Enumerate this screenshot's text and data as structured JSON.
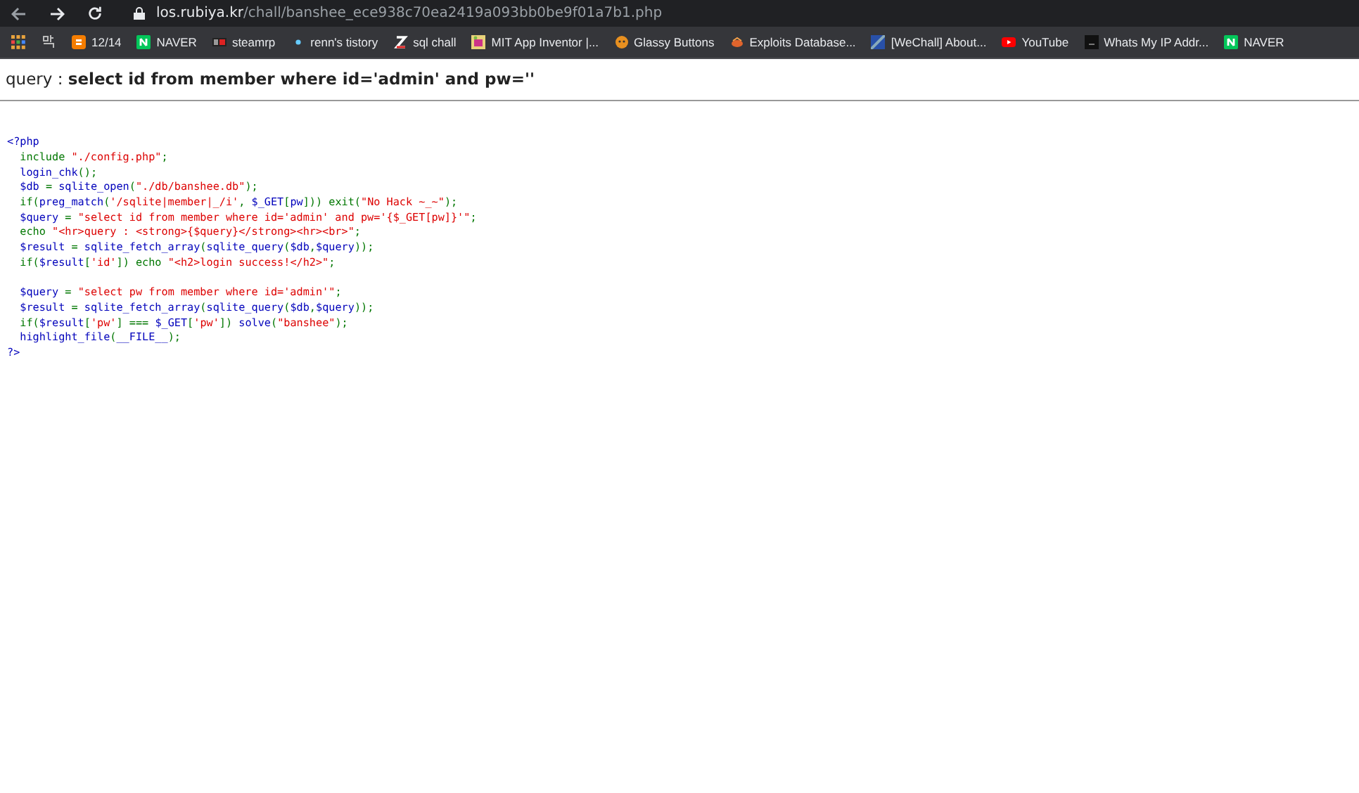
{
  "browser": {
    "url_host": "los.rubiya.kr",
    "url_path": "/chall/banshee_ece938c70ea2419a093bb0be9f01a7b1.php"
  },
  "bookmarks": [
    {
      "label": "12/14",
      "kind": "blogger"
    },
    {
      "label": "NAVER",
      "kind": "naver"
    },
    {
      "label": "steamrp",
      "kind": "steam"
    },
    {
      "label": "renn's tistory",
      "kind": "dot"
    },
    {
      "label": "sql chall",
      "kind": "z"
    },
    {
      "label": "MIT App Inventor |...",
      "kind": "mit"
    },
    {
      "label": "Glassy Buttons",
      "kind": "glassy"
    },
    {
      "label": "Exploits Database...",
      "kind": "exploit"
    },
    {
      "label": "[WeChall] About...",
      "kind": "wechall"
    },
    {
      "label": "YouTube",
      "kind": "youtube"
    },
    {
      "label": "Whats My IP Addr...",
      "kind": "dark"
    },
    {
      "label": "NAVER",
      "kind": "naver"
    }
  ],
  "query_line": "query : **select id from member where id='admin' and pw=''**",
  "code_groups": [
    [
      [
        {
          "text": "<?php",
          "kind": "default"
        }
      ],
      [
        {
          "text": "  include ",
          "kind": "keyword"
        },
        {
          "text": "\"./config.php\"",
          "kind": "string"
        },
        {
          "text": ";",
          "kind": "keyword"
        }
      ],
      [
        {
          "text": "  login_chk",
          "kind": "default"
        },
        {
          "text": "();",
          "kind": "keyword"
        }
      ],
      [
        {
          "text": "  $db ",
          "kind": "default"
        },
        {
          "text": "= ",
          "kind": "keyword"
        },
        {
          "text": "sqlite_open",
          "kind": "default"
        },
        {
          "text": "(",
          "kind": "keyword"
        },
        {
          "text": "\"./db/banshee.db\"",
          "kind": "string"
        },
        {
          "text": ");",
          "kind": "keyword"
        }
      ],
      [
        {
          "text": "  if(",
          "kind": "keyword"
        },
        {
          "text": "preg_match",
          "kind": "default"
        },
        {
          "text": "(",
          "kind": "keyword"
        },
        {
          "text": "'/sqlite|member|_/i'",
          "kind": "string"
        },
        {
          "text": ", ",
          "kind": "keyword"
        },
        {
          "text": "$_GET",
          "kind": "default"
        },
        {
          "text": "[",
          "kind": "keyword"
        },
        {
          "text": "pw",
          "kind": "default"
        },
        {
          "text": "])) exit(",
          "kind": "keyword"
        },
        {
          "text": "\"No Hack ~_~\"",
          "kind": "string"
        },
        {
          "text": ");",
          "kind": "keyword"
        }
      ],
      [
        {
          "text": "  $query ",
          "kind": "default"
        },
        {
          "text": "= ",
          "kind": "keyword"
        },
        {
          "text": "\"select id from member where id='admin' and pw='{$_GET[pw]}'\"",
          "kind": "string"
        },
        {
          "text": ";",
          "kind": "keyword"
        }
      ],
      [
        {
          "text": "  echo ",
          "kind": "keyword"
        },
        {
          "text": "\"<hr>query : <strong>{$query}</strong><hr><br>\"",
          "kind": "string"
        },
        {
          "text": ";",
          "kind": "keyword"
        }
      ],
      [
        {
          "text": "  $result ",
          "kind": "default"
        },
        {
          "text": "= ",
          "kind": "keyword"
        },
        {
          "text": "sqlite_fetch_array",
          "kind": "default"
        },
        {
          "text": "(",
          "kind": "keyword"
        },
        {
          "text": "sqlite_query",
          "kind": "default"
        },
        {
          "text": "(",
          "kind": "keyword"
        },
        {
          "text": "$db",
          "kind": "default"
        },
        {
          "text": ",",
          "kind": "keyword"
        },
        {
          "text": "$query",
          "kind": "default"
        },
        {
          "text": "));",
          "kind": "keyword"
        }
      ],
      [
        {
          "text": "  if(",
          "kind": "keyword"
        },
        {
          "text": "$result",
          "kind": "default"
        },
        {
          "text": "[",
          "kind": "keyword"
        },
        {
          "text": "'id'",
          "kind": "string"
        },
        {
          "text": "]) echo ",
          "kind": "keyword"
        },
        {
          "text": "\"<h2>login success!</h2>\"",
          "kind": "string"
        },
        {
          "text": ";",
          "kind": "keyword"
        }
      ]
    ],
    [
      [
        {
          "text": "  $query ",
          "kind": "default"
        },
        {
          "text": "= ",
          "kind": "keyword"
        },
        {
          "text": "\"select pw from member where id='admin'\"",
          "kind": "string"
        },
        {
          "text": ";",
          "kind": "keyword"
        }
      ],
      [
        {
          "text": "  $result ",
          "kind": "default"
        },
        {
          "text": "= ",
          "kind": "keyword"
        },
        {
          "text": "sqlite_fetch_array",
          "kind": "default"
        },
        {
          "text": "(",
          "kind": "keyword"
        },
        {
          "text": "sqlite_query",
          "kind": "default"
        },
        {
          "text": "(",
          "kind": "keyword"
        },
        {
          "text": "$db",
          "kind": "default"
        },
        {
          "text": ",",
          "kind": "keyword"
        },
        {
          "text": "$query",
          "kind": "default"
        },
        {
          "text": "));",
          "kind": "keyword"
        }
      ],
      [
        {
          "text": "  if(",
          "kind": "keyword"
        },
        {
          "text": "$result",
          "kind": "default"
        },
        {
          "text": "[",
          "kind": "keyword"
        },
        {
          "text": "'pw'",
          "kind": "string"
        },
        {
          "text": "] === ",
          "kind": "keyword"
        },
        {
          "text": "$_GET",
          "kind": "default"
        },
        {
          "text": "[",
          "kind": "keyword"
        },
        {
          "text": "'pw'",
          "kind": "string"
        },
        {
          "text": "]) ",
          "kind": "keyword"
        },
        {
          "text": "solve",
          "kind": "default"
        },
        {
          "text": "(",
          "kind": "keyword"
        },
        {
          "text": "\"banshee\"",
          "kind": "string"
        },
        {
          "text": ");",
          "kind": "keyword"
        }
      ],
      [
        {
          "text": "  highlight_file",
          "kind": "default"
        },
        {
          "text": "(",
          "kind": "keyword"
        },
        {
          "text": "__FILE__",
          "kind": "default"
        },
        {
          "text": ");",
          "kind": "keyword"
        }
      ],
      [
        {
          "text": "?>",
          "kind": "default"
        }
      ]
    ]
  ]
}
